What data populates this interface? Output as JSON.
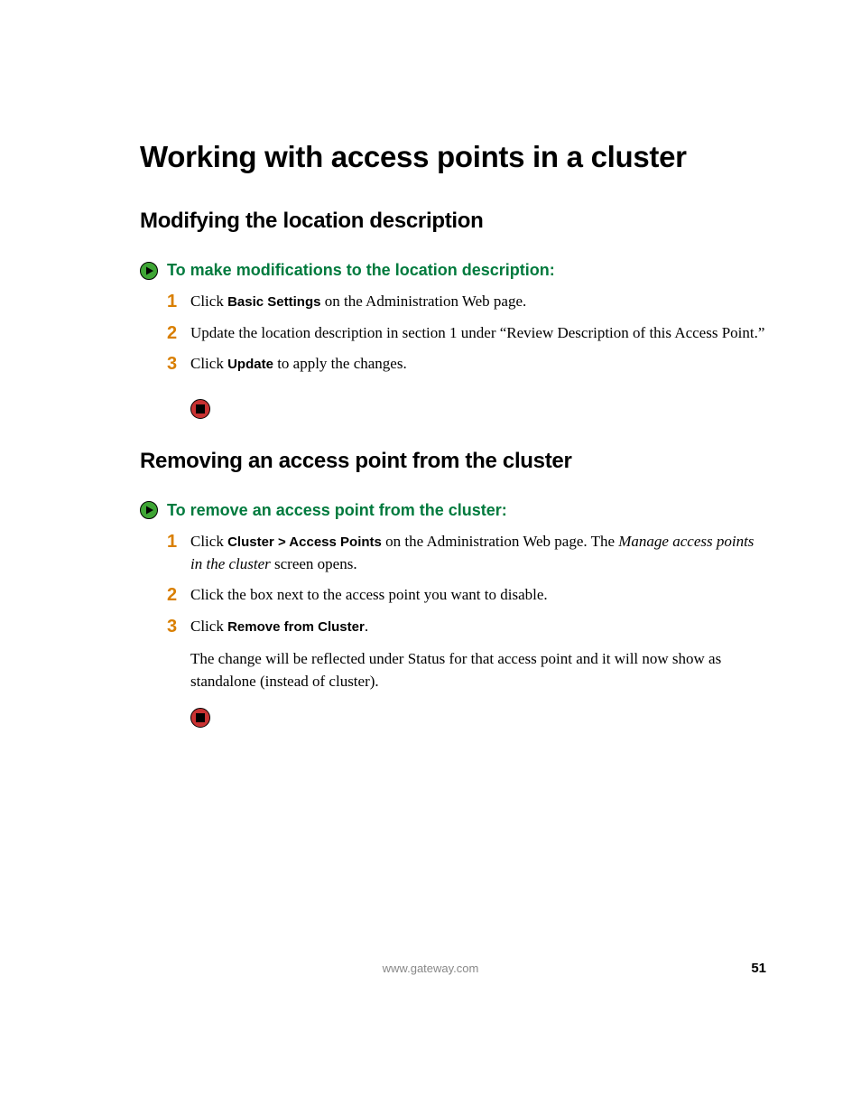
{
  "h1": "Working with access points in a cluster",
  "section1": {
    "h2": "Modifying the location description",
    "task_title": "To make modifications to the location description:",
    "steps": [
      {
        "num": "1",
        "pre": "Click ",
        "bold": "Basic Settings",
        "post": " on the Administration Web page."
      },
      {
        "num": "2",
        "text": "Update the location description in section 1 under “Review Description of this Access Point.”"
      },
      {
        "num": "3",
        "pre": "Click ",
        "bold": "Update",
        "post": " to apply the changes."
      }
    ]
  },
  "section2": {
    "h2": "Removing an access point from the cluster",
    "task_title": "To remove an access point from the cluster:",
    "steps": [
      {
        "num": "1",
        "pre": "Click ",
        "bold": "Cluster > Access Points",
        "mid": " on the Administration Web page. The ",
        "italic": "Manage access points in the cluster",
        "post": " screen opens."
      },
      {
        "num": "2",
        "text": "Click the box next to the access point you want to disable."
      },
      {
        "num": "3",
        "pre": "Click ",
        "bold": "Remove from Cluster",
        "post": "."
      }
    ],
    "para": "The change will be reflected under Status for that access point and it will now show as standalone (instead of cluster)."
  },
  "footer": {
    "url": "www.gateway.com",
    "page": "51"
  }
}
